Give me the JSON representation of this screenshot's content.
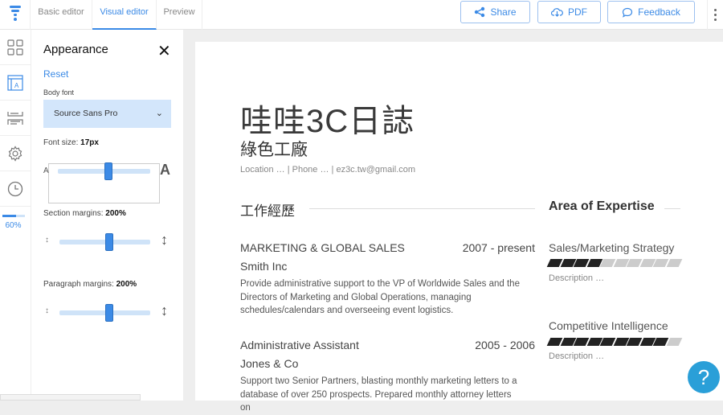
{
  "tabs": [
    {
      "label": "Basic editor"
    },
    {
      "label": "Visual editor"
    },
    {
      "label": "Preview"
    }
  ],
  "actions": {
    "share": "Share",
    "pdf": "PDF",
    "feedback": "Feedback"
  },
  "rail": {
    "progress_label": "60%",
    "progress": 0.6
  },
  "panel": {
    "title": "Appearance",
    "reset": "Reset",
    "body_font_label": "Body font",
    "body_font_value": "Source Sans Pro",
    "font_size_label": "Font size:",
    "font_size_value": "17px",
    "section_margins_label": "Section margins:",
    "section_margins_value": "200%",
    "paragraph_margins_label": "Paragraph margins:",
    "paragraph_margins_value": "200%",
    "font_size_slider": 0.55,
    "section_slider": 0.55,
    "paragraph_slider": 0.55
  },
  "resume": {
    "name": "哇哇3C日誌",
    "subtitle": "綠色工廠",
    "contact": "Location … | Phone … | ez3c.tw@gmail.com",
    "experience_heading": "工作經歷",
    "expertise_heading": "Area of Expertise",
    "jobs": [
      {
        "title": "MARKETING & GLOBAL SALES",
        "dates": "2007 - present",
        "company": "Smith Inc",
        "description": "Provide administrative support to the VP of Worldwide Sales and the Directors of Marketing and Global Operations, managing schedules/calendars and overseeing event logistics."
      },
      {
        "title": "Administrative Assistant",
        "dates": "2005 - 2006",
        "company": "Jones & Co",
        "description": "Support two Senior Partners, blasting monthly marketing letters to a database of over 250 prospects. Prepared monthly attorney letters on"
      }
    ],
    "skills": [
      {
        "name": "Sales/Marketing Strategy",
        "level": 4,
        "max": 10,
        "description": "Description …"
      },
      {
        "name": "Competitive Intelligence",
        "level": 9,
        "max": 10,
        "description": "Description …"
      }
    ]
  },
  "help": "?",
  "colors": {
    "accent": "#3b8ae6",
    "filled": "#222222",
    "empty": "#cccccc",
    "help": "#2a9fd8"
  }
}
